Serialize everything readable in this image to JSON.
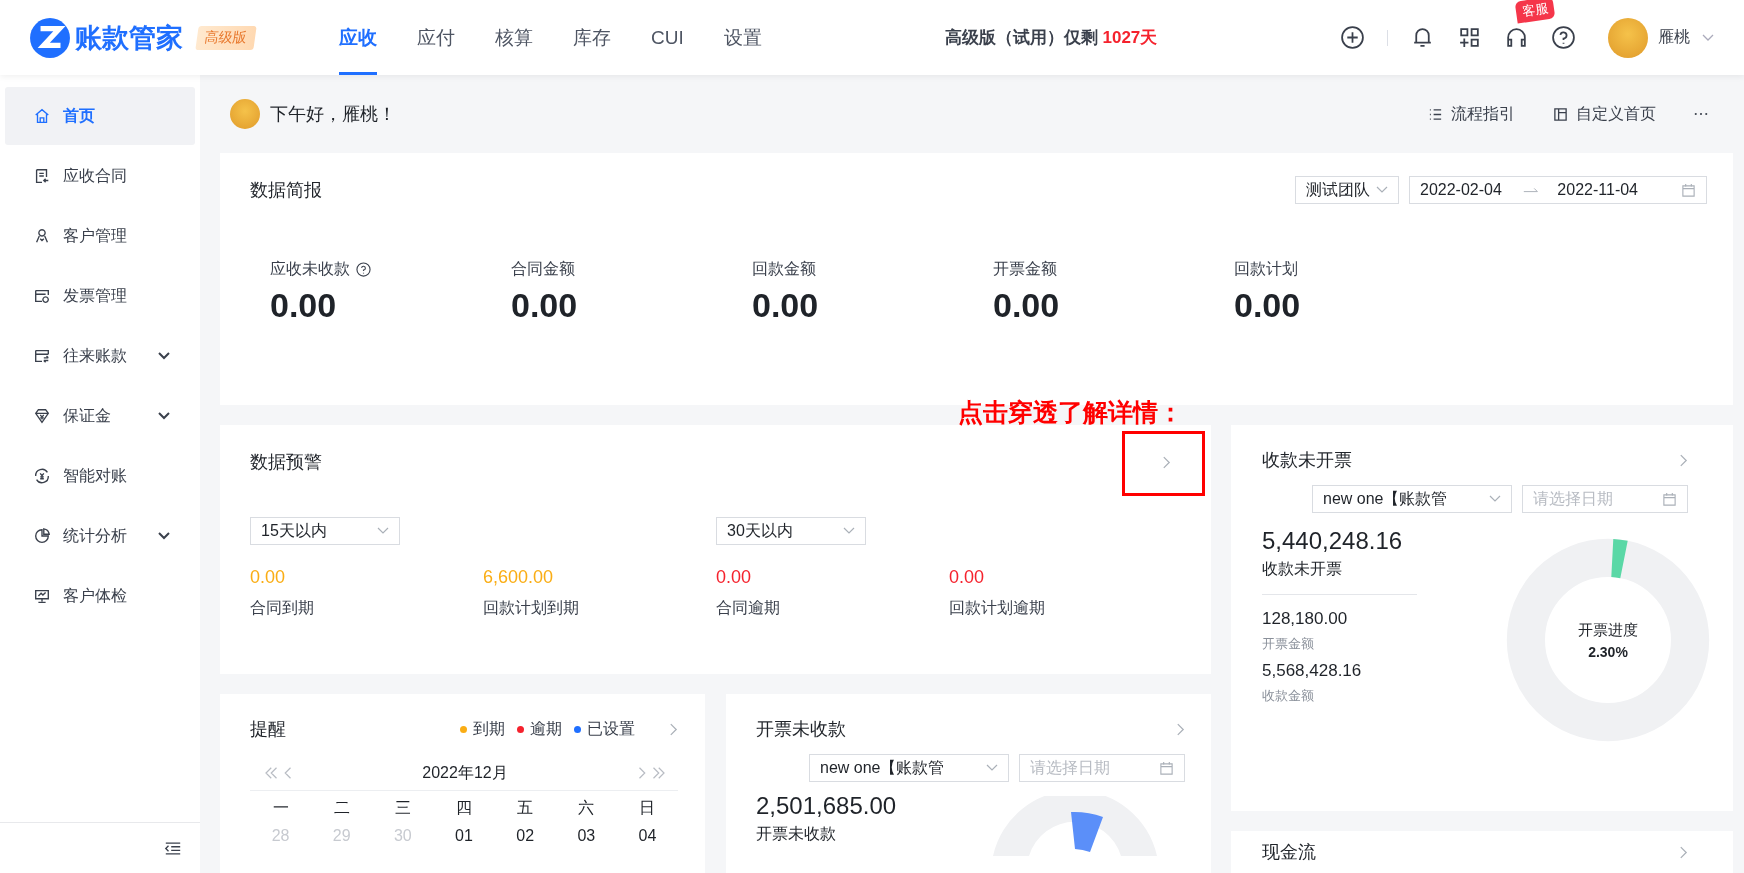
{
  "app": {
    "logo_text": "账款管家",
    "edition_badge": "高级版"
  },
  "nav_tabs": [
    {
      "label": "应收",
      "selected": true
    },
    {
      "label": "应付",
      "selected": false
    },
    {
      "label": "核算",
      "selected": false
    },
    {
      "label": "库存",
      "selected": false
    },
    {
      "label": "CUI",
      "selected": false
    },
    {
      "label": "设置",
      "selected": false
    }
  ],
  "trial_notice": {
    "text": "高级版（试用）仅剩",
    "days": "1027天"
  },
  "header": {
    "support_badge": "客服",
    "user_name": "雁桃"
  },
  "sidebar": {
    "items": [
      {
        "label": "首页",
        "selected": true,
        "expandable": false
      },
      {
        "label": "应收合同",
        "selected": false,
        "expandable": false
      },
      {
        "label": "客户管理",
        "selected": false,
        "expandable": false
      },
      {
        "label": "发票管理",
        "selected": false,
        "expandable": false
      },
      {
        "label": "往来账款",
        "selected": false,
        "expandable": true
      },
      {
        "label": "保证金",
        "selected": false,
        "expandable": true
      },
      {
        "label": "智能对账",
        "selected": false,
        "expandable": false
      },
      {
        "label": "统计分析",
        "selected": false,
        "expandable": true
      },
      {
        "label": "客户体检",
        "selected": false,
        "expandable": false
      }
    ]
  },
  "greeting": "下午好，雁桃！",
  "page_actions": [
    {
      "label": "流程指引"
    },
    {
      "label": "自定义首页"
    }
  ],
  "summary": {
    "title": "数据简报",
    "team_select": "测试团队",
    "date_start": "2022-02-04",
    "date_end": "2022-11-04",
    "metrics": [
      {
        "label": "应收未收款",
        "value": "0.00",
        "help": true
      },
      {
        "label": "合同金额",
        "value": "0.00",
        "help": false
      },
      {
        "label": "回款金额",
        "value": "0.00",
        "help": false
      },
      {
        "label": "开票金额",
        "value": "0.00",
        "help": false
      },
      {
        "label": "回款计划",
        "value": "0.00",
        "help": false
      }
    ]
  },
  "annotation": {
    "text": "点击穿透了解详情："
  },
  "warning": {
    "title": "数据预警",
    "groups": [
      {
        "filter": "15天以内",
        "metrics": [
          {
            "value": "0.00",
            "label": "合同到期",
            "color": "#faad14"
          },
          {
            "value": "6,600.00",
            "label": "回款计划到期",
            "color": "#faad14"
          }
        ]
      },
      {
        "filter": "30天以内",
        "metrics": [
          {
            "value": "0.00",
            "label": "合同逾期",
            "color": "#f5222d"
          },
          {
            "value": "0.00",
            "label": "回款计划逾期",
            "color": "#f5222d"
          }
        ]
      }
    ]
  },
  "uninvoiced": {
    "title": "收款未开票",
    "select": "new one【账款管",
    "date_placeholder": "请选择日期",
    "amount": "5,440,248.16",
    "amount_label": "收款未开票",
    "details": [
      {
        "value": "128,180.00",
        "label": "开票金额"
      },
      {
        "value": "5,568,428.16",
        "label": "收款金额"
      }
    ],
    "progress": {
      "label": "开票进度",
      "reading": "2.30%",
      "level": 0.023
    }
  },
  "reminder": {
    "title": "提醒",
    "legend": [
      {
        "label": "到期",
        "color": "#faad14"
      },
      {
        "label": "逾期",
        "color": "#f5222d"
      },
      {
        "label": "已设置",
        "color": "#1f6fff"
      }
    ],
    "month": "2022年12月",
    "weekdays": [
      "一",
      "二",
      "三",
      "四",
      "五",
      "六",
      "日"
    ],
    "dates": [
      {
        "day": "28",
        "in_month": false
      },
      {
        "day": "29",
        "in_month": false
      },
      {
        "day": "30",
        "in_month": false
      },
      {
        "day": "01",
        "in_month": true
      },
      {
        "day": "02",
        "in_month": true
      },
      {
        "day": "03",
        "in_month": true
      },
      {
        "day": "04",
        "in_month": true
      }
    ]
  },
  "invoiced_unpaid": {
    "title": "开票未收款",
    "select": "new one【账款管",
    "date_placeholder": "请选择日期",
    "amount": "2,501,685.00",
    "amount_label": "开票未收款"
  },
  "cash_flow": {
    "title": "现金流"
  }
}
